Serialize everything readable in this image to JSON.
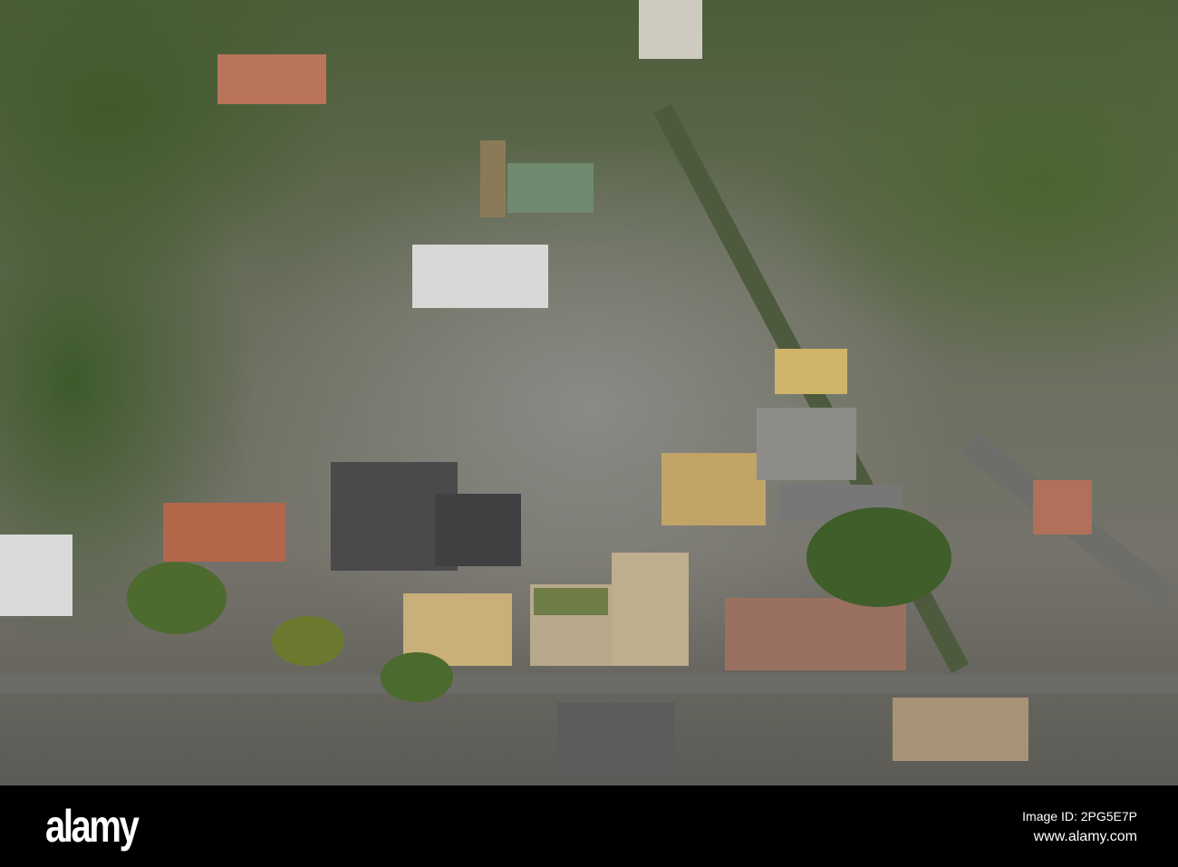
{
  "watermark": {
    "logo": "alamy",
    "image_id": "Image ID: 2PG5E7P",
    "url": "www.alamy.com"
  },
  "colors": {
    "bar": "#000000",
    "text": "#ffffff"
  }
}
